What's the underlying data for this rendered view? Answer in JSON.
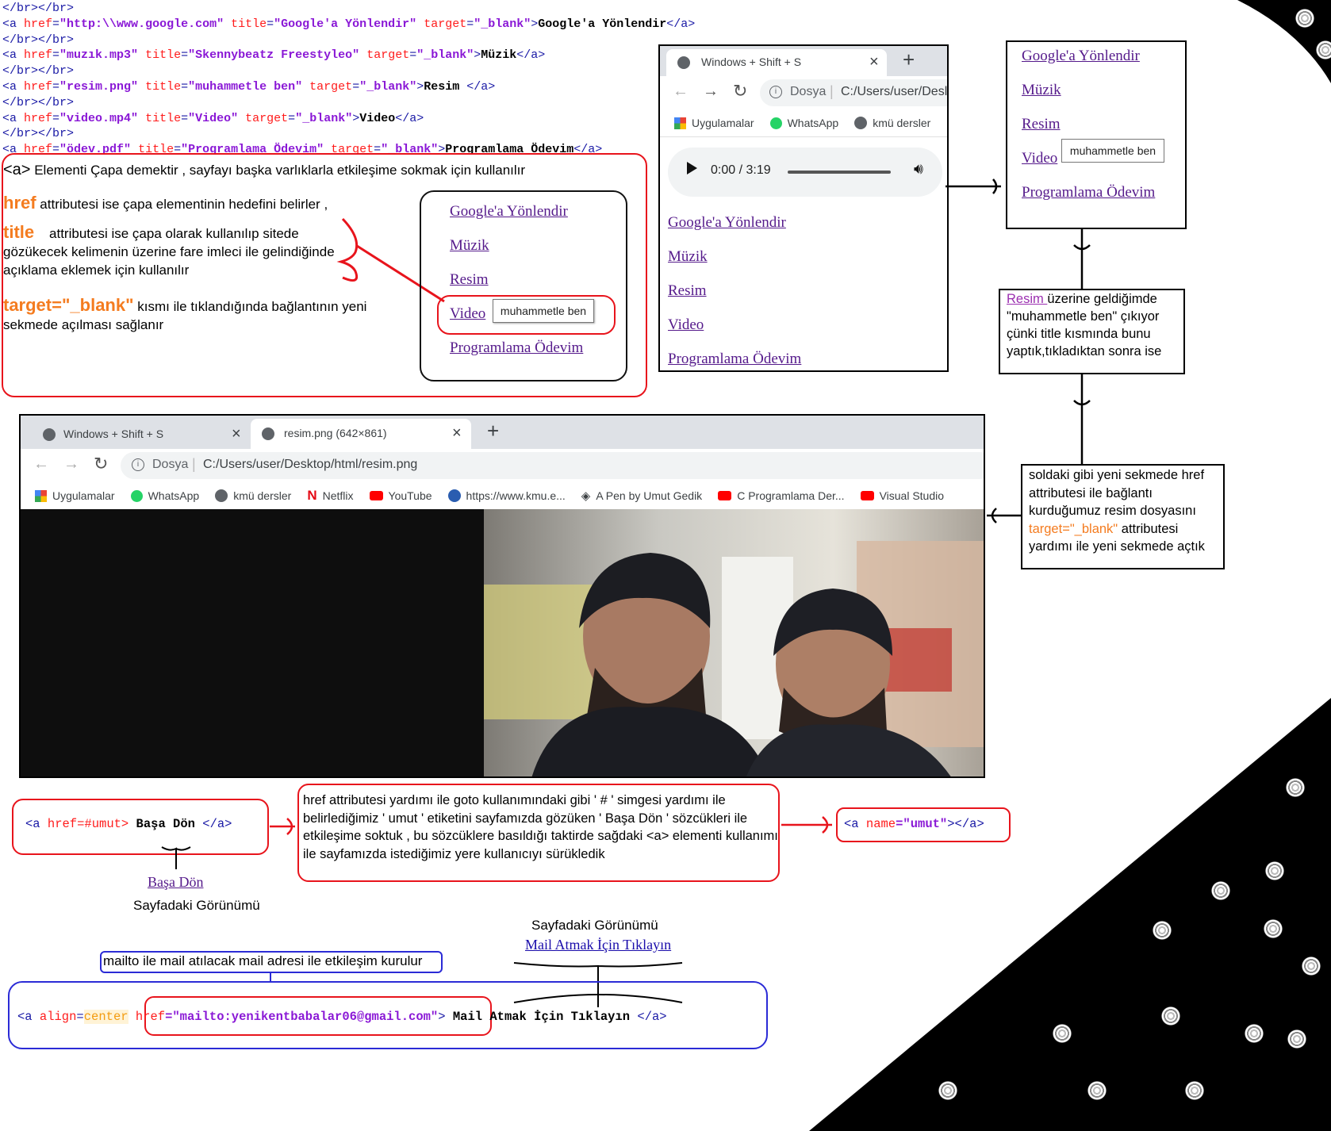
{
  "code_lines": [
    {
      "parts": [
        {
          "c": "tag",
          "t": "</br></br>"
        }
      ]
    },
    {
      "parts": [
        {
          "c": "tag",
          "t": "<a "
        },
        {
          "c": "attr",
          "t": "href"
        },
        {
          "c": "tag",
          "t": "="
        },
        {
          "c": "val",
          "t": "\"http:\\\\www.google.com\""
        },
        {
          "c": "tag",
          "t": " "
        },
        {
          "c": "attr",
          "t": "title"
        },
        {
          "c": "tag",
          "t": "="
        },
        {
          "c": "val",
          "t": "\"Google'a Yönlendir\""
        },
        {
          "c": "tag",
          "t": " "
        },
        {
          "c": "attr",
          "t": "target"
        },
        {
          "c": "tag",
          "t": "="
        },
        {
          "c": "val",
          "t": "\"_blank\""
        },
        {
          "c": "tag",
          "t": ">"
        },
        {
          "c": "txt",
          "t": "Google'a Yönlendir"
        },
        {
          "c": "tag",
          "t": "</a>"
        }
      ]
    },
    {
      "parts": [
        {
          "c": "tag",
          "t": "</br></br>"
        }
      ]
    },
    {
      "parts": [
        {
          "c": "tag",
          "t": "<a "
        },
        {
          "c": "attr",
          "t": "href"
        },
        {
          "c": "tag",
          "t": "="
        },
        {
          "c": "val",
          "t": "\"muzık.mp3\""
        },
        {
          "c": "tag",
          "t": " "
        },
        {
          "c": "attr",
          "t": "title"
        },
        {
          "c": "tag",
          "t": "="
        },
        {
          "c": "val",
          "t": "\"Skennybeatz Freestyleo\""
        },
        {
          "c": "tag",
          "t": " "
        },
        {
          "c": "attr",
          "t": "target"
        },
        {
          "c": "tag",
          "t": "="
        },
        {
          "c": "val",
          "t": "\"_blank\""
        },
        {
          "c": "tag",
          "t": ">"
        },
        {
          "c": "txt",
          "t": "Müzik"
        },
        {
          "c": "tag",
          "t": "</a>"
        }
      ]
    },
    {
      "parts": [
        {
          "c": "tag",
          "t": "</br></br>"
        }
      ]
    },
    {
      "parts": [
        {
          "c": "tag",
          "t": "<a "
        },
        {
          "c": "attr",
          "t": "href"
        },
        {
          "c": "tag",
          "t": "="
        },
        {
          "c": "val",
          "t": "\"resim.png\""
        },
        {
          "c": "tag",
          "t": " "
        },
        {
          "c": "attr",
          "t": "title"
        },
        {
          "c": "tag",
          "t": "="
        },
        {
          "c": "val",
          "t": "\"muhammetle ben\""
        },
        {
          "c": "tag",
          "t": " "
        },
        {
          "c": "attr",
          "t": "target"
        },
        {
          "c": "tag",
          "t": "="
        },
        {
          "c": "val",
          "t": "\"_blank\""
        },
        {
          "c": "tag",
          "t": ">"
        },
        {
          "c": "txt",
          "t": "Resim "
        },
        {
          "c": "tag",
          "t": "</a>"
        }
      ]
    },
    {
      "parts": [
        {
          "c": "tag",
          "t": "</br></br>"
        }
      ]
    },
    {
      "parts": [
        {
          "c": "tag",
          "t": "<a "
        },
        {
          "c": "attr",
          "t": "href"
        },
        {
          "c": "tag",
          "t": "="
        },
        {
          "c": "val",
          "t": "\"video.mp4\""
        },
        {
          "c": "tag",
          "t": " "
        },
        {
          "c": "attr",
          "t": "title"
        },
        {
          "c": "tag",
          "t": "="
        },
        {
          "c": "val",
          "t": "\"Video\""
        },
        {
          "c": "tag",
          "t": " "
        },
        {
          "c": "attr",
          "t": "target"
        },
        {
          "c": "tag",
          "t": "="
        },
        {
          "c": "val",
          "t": "\"_blank\""
        },
        {
          "c": "tag",
          "t": ">"
        },
        {
          "c": "txt",
          "t": "Video"
        },
        {
          "c": "tag",
          "t": "</a>"
        }
      ]
    },
    {
      "parts": [
        {
          "c": "tag",
          "t": "</br></br>"
        }
      ]
    },
    {
      "parts": [
        {
          "c": "tag",
          "t": "<a "
        },
        {
          "c": "attr",
          "t": "href"
        },
        {
          "c": "tag",
          "t": "="
        },
        {
          "c": "val",
          "t": "\"ödev.pdf\""
        },
        {
          "c": "tag",
          "t": " "
        },
        {
          "c": "attr",
          "t": "title"
        },
        {
          "c": "tag",
          "t": "="
        },
        {
          "c": "val",
          "t": "\"Programlama Ödevim\""
        },
        {
          "c": "tag",
          "t": " "
        },
        {
          "c": "attr",
          "t": "target"
        },
        {
          "c": "tag",
          "t": "="
        },
        {
          "c": "val",
          "t": "\"_blank\""
        },
        {
          "c": "tag",
          "t": ">"
        },
        {
          "c": "txt",
          "t": "Programlama Ödevim"
        },
        {
          "c": "tag",
          "t": "</a>"
        }
      ]
    }
  ],
  "explain": {
    "a_tag": "<a>",
    "a_desc": "Elementi Çapa demektir , sayfayı başka varlıklarla etkileşime sokmak için kullanılır",
    "href_key": "href",
    "href_desc": "attributesi ise çapa elementinin hedefini belirler ,",
    "title_key": "title",
    "title_desc": "attributesi ise çapa olarak kullanılıp sitede gözükecek kelimenin üzerine fare imleci ile gelindiğinde açıklama eklemek için kullanılır",
    "target_key": "target=\"_blank\"",
    "target_desc": "kısmı ile tıklandığında bağlantının yeni sekmede açılması sağlanır"
  },
  "links": [
    "Google'a Yönlendir",
    "Müzik",
    "Resim",
    "Video",
    "Programlama Ödevim"
  ],
  "tooltip": "muhammetle ben",
  "browser_small": {
    "tab_title": "Windows + Shift + S",
    "close": "×",
    "new_tab": "+",
    "address_label": "Dosya",
    "address_path": "C:/Users/user/Desl",
    "bookmarks": [
      "Uygulamalar",
      "WhatsApp",
      "kmü dersler"
    ],
    "audio_time": "0:00 / 3:19"
  },
  "note_resim": {
    "link": "Resim ",
    "text": "üzerine geldiğimde \"muhammetle ben\" çıkıyor çünki title kısmında bunu yaptık,tıkladıktan sonra ise"
  },
  "note_newtab": {
    "text1": "soldaki gibi yeni sekmede href attributesi ile bağlantı kurduğumuz resim dosyasını",
    "key": "target=\"_blank\"",
    "text2": "attributesi yardımı ile yeni sekmede açtık"
  },
  "browser_big": {
    "tab1": "Windows + Shift + S",
    "tab2": "resim.png (642×861)",
    "close": "×",
    "new_tab": "+",
    "address_label": "Dosya",
    "address_path": "C:/Users/user/Desktop/html/resim.png",
    "bookmarks": [
      "Uygulamalar",
      "WhatsApp",
      "kmü dersler",
      "Netflix",
      "YouTube",
      "https://www.kmu.e...",
      "A Pen by Umut Gedik",
      "C Programlama Der...",
      "Visual Studio"
    ]
  },
  "anchor_section": {
    "code_tag_open": "<a ",
    "code_attr": "href",
    "code_val": "=#umut>",
    "code_text": " Başa Dön ",
    "code_tag_close": "</a>",
    "rendered": "Başa Dön",
    "caption": "Sayfadaki Görünümü",
    "explain": "href attributesi yardımı ile goto kullanımındaki gibi ' # ' simgesi yardımı ile belirlediğimiz ' umut ' etiketini sayfamızda gözüken ' Başa Dön ' sözcükleri ile etkileşime soktuk , bu sözcüklere basıldığı taktirde sağdaki <a> elementi kullanımı ile sayfamızda istediğimiz yere kullanıcıyı sürükledik",
    "target_code_open": "<a ",
    "target_code_attr": "name",
    "target_code_val": "=\"umut\"",
    "target_code_close": "></a>"
  },
  "mail_section": {
    "caption": "Sayfadaki Görünümü",
    "rendered": "Mail Atmak İçin Tıklayın",
    "note": "mailto ile mail atılacak mail adresi ile etkileşim kurulur",
    "code_open": "<a ",
    "code_align_attr": "align",
    "code_align_val": "center",
    "code_href_attr": "href",
    "code_href_val": "=\"mailto:yenikentbabalar06@gmail.com\"",
    "code_gt": ">",
    "code_text": " Mail Atmak İçin Tıklayın ",
    "code_close": "</a>"
  },
  "colors": {
    "red": "#e8141c",
    "blue": "#2b2bd6",
    "tag_blue": "#1a1aa6",
    "attr_red": "#ff1c1c",
    "val_purple": "#8a18d6",
    "orange": "#f47c20"
  }
}
